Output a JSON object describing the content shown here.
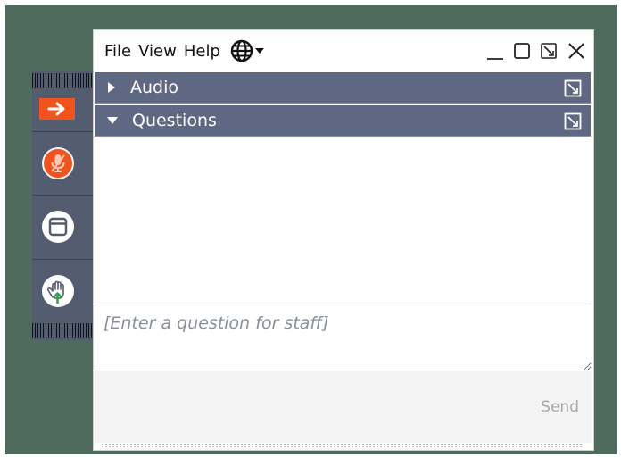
{
  "menu": {
    "file": "File",
    "view": "View",
    "help": "Help"
  },
  "icons": {
    "globe": "globe-icon",
    "dropdown": "caret-down-icon",
    "minimize": "minimize-icon",
    "maximize": "maximize-icon",
    "popout": "popout-icon",
    "close": "close-icon",
    "collapse": "arrow-right-icon",
    "mic": "microphone-muted-icon",
    "window": "window-icon",
    "hand": "raise-hand-icon"
  },
  "panels": {
    "audio_label": "Audio",
    "questions_label": "Questions"
  },
  "question_input": {
    "value": "",
    "placeholder": "[Enter a question for staff]"
  },
  "send_label": "Send",
  "colors": {
    "desktop": "#4e6b5d",
    "strip": "#545c70",
    "accent_orange": "#f0541c",
    "panel_header": "#5f6882"
  }
}
